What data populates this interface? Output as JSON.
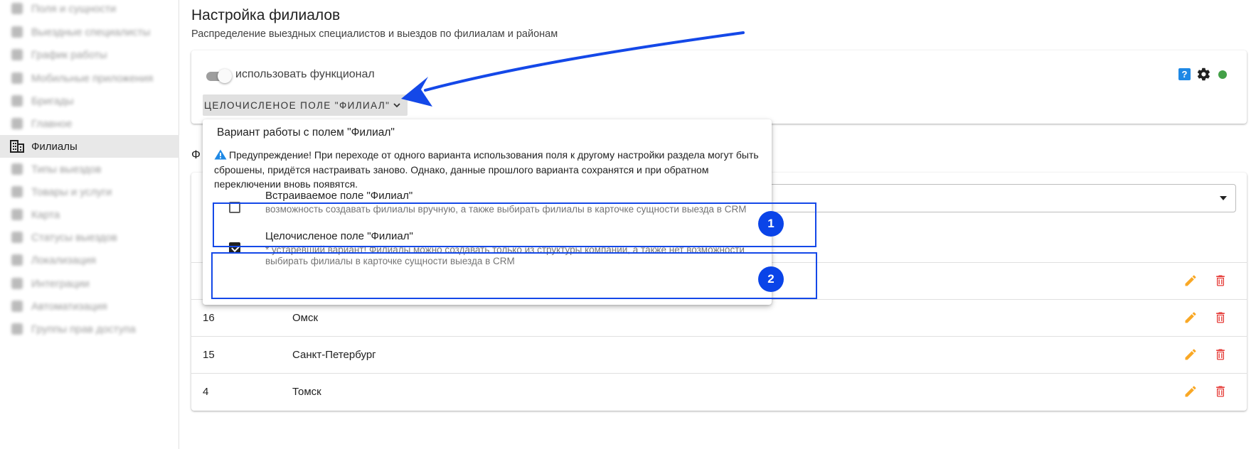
{
  "sidebar": {
    "items": [
      {
        "label": "Поля и сущности",
        "icon": "gear-icon",
        "blurred": true
      },
      {
        "label": "Выездные специалисты",
        "icon": "person-icon",
        "blurred": true
      },
      {
        "label": "График работы",
        "icon": "calendar-icon",
        "blurred": true
      },
      {
        "label": "Мобильные приложения",
        "icon": "phone-icon",
        "blurred": true
      },
      {
        "label": "Бригады",
        "icon": "truck-icon",
        "blurred": true
      },
      {
        "label": "Главное",
        "icon": "star-icon",
        "blurred": true
      },
      {
        "label": "Филиалы",
        "icon": "building-icon",
        "blurred": false,
        "active": true
      },
      {
        "label": "Типы выездов",
        "icon": "list-icon",
        "blurred": true
      },
      {
        "label": "Товары и услуги",
        "icon": "box-icon",
        "blurred": true
      },
      {
        "label": "Карта",
        "icon": "map-icon",
        "blurred": true
      },
      {
        "label": "Статусы выездов",
        "icon": "status-icon",
        "blurred": true
      },
      {
        "label": "Локализация",
        "icon": "language-icon",
        "blurred": true
      },
      {
        "label": "Интеграции",
        "icon": "integration-icon",
        "blurred": true
      },
      {
        "label": "Автоматизация",
        "icon": "automation-icon",
        "blurred": true
      },
      {
        "label": "Группы прав доступа",
        "icon": "shield-icon",
        "blurred": true
      }
    ]
  },
  "header": {
    "title": "Настройка филиалов",
    "subtitle": "Распределение выездных специалистов и выездов по филиалам и районам"
  },
  "settings": {
    "toggle_label": "использовать функционал",
    "toggle_on": true,
    "mode_button_label": "ЦЕЛОЧИСЛЕНОЕ ПОЛЕ \"ФИЛИАЛ\"",
    "help_symbol": "?",
    "status_color": "#43a047"
  },
  "section_letter": "Ф",
  "popup": {
    "title": "Вариант работы с полем \"Филиал\"",
    "warning": "Предупреждение! При переходе от одного варианта использования поля к другому настройки раздела могут быть сброшены, придётся настраивать заново. Однако, данные прошлого варианта сохранятся и при обратном переключении вновь появятся.",
    "options": [
      {
        "title": "Встраиваемое поле \"Филиал\"",
        "description": "возможность создавать филиалы вручную, а также выбирать филиалы в карточке сущности выезда в CRM",
        "checked": false
      },
      {
        "title": "Целочисленое поле \"Филиал\"",
        "description": "* устаревший вариант! Филиалы можно создавать только из структуры компании, а также нет возможности выбирать филиалы в карточке сущности выезда в CRM",
        "checked": true
      }
    ]
  },
  "table": {
    "rows": [
      {
        "id": "",
        "name": ""
      },
      {
        "id": "16",
        "name": "Омск"
      },
      {
        "id": "15",
        "name": "Санкт-Петербург"
      },
      {
        "id": "4",
        "name": "Томск"
      }
    ]
  },
  "annotations": {
    "badges": [
      "1",
      "2"
    ],
    "color": "#1448e8"
  },
  "colors": {
    "edit": "#f9a825",
    "delete": "#e53935",
    "accent": "#1e88e5"
  }
}
